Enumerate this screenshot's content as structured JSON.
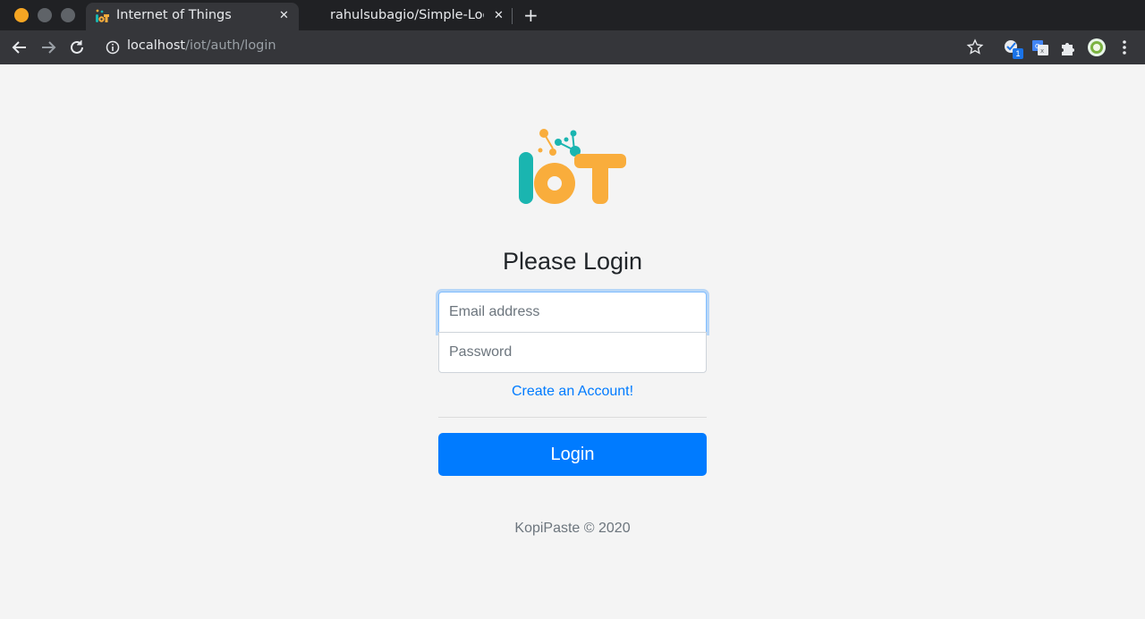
{
  "browser": {
    "tabs": [
      {
        "title": "Internet of Things",
        "active": true
      },
      {
        "title": "rahulsubagio/Simple-Log",
        "active": false
      }
    ],
    "new_tab_label": "+",
    "close_label": "✕",
    "url_host": "localhost",
    "url_path": "/iot/auth/login",
    "extension_badge": "1",
    "colors": {
      "window_close": "#f6a623",
      "window_other": "#5f6368"
    }
  },
  "page": {
    "logo_text": "IoT",
    "title": "Please Login",
    "email_placeholder": "Email address",
    "password_placeholder": "Password",
    "create_account": "Create an Account!",
    "login_button": "Login",
    "footer": "KopiPaste © 2020",
    "colors": {
      "primary": "#007bff",
      "logo_teal": "#1ab5b0",
      "logo_orange": "#f9ad3c"
    }
  }
}
